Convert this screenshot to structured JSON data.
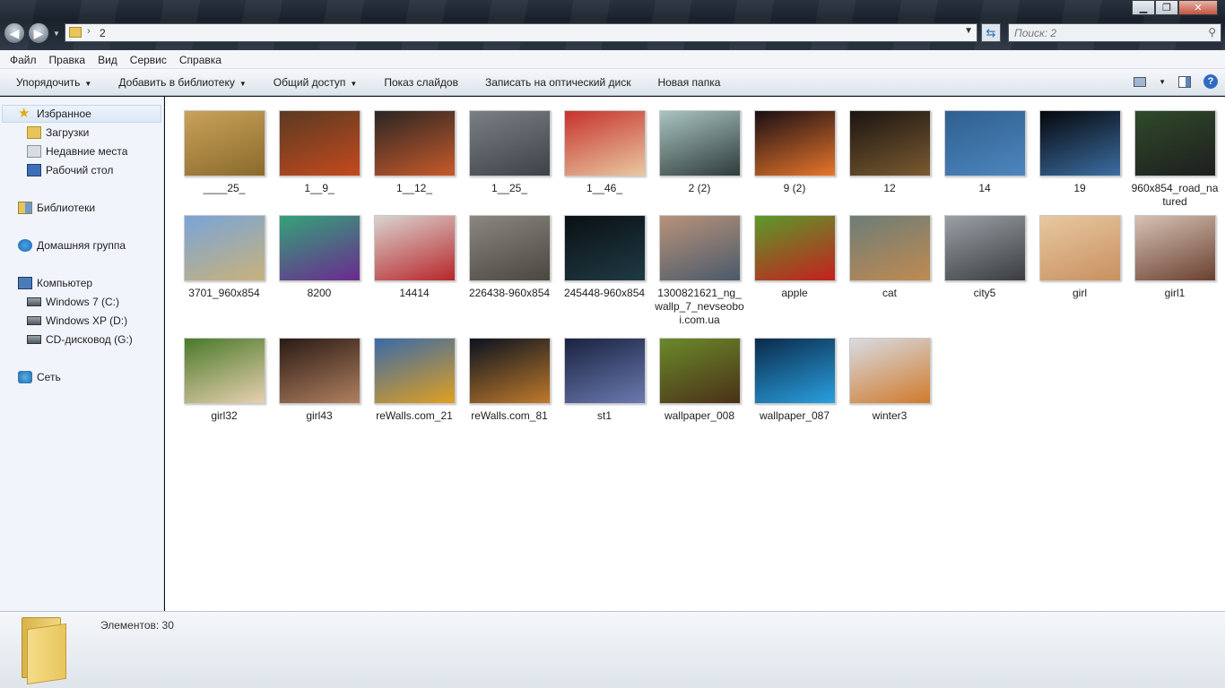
{
  "window": {
    "controls": {
      "minimize": "▁",
      "maximize": "❐",
      "close": "✕"
    }
  },
  "address": {
    "path": "2",
    "dropdown_icon": "chevron-down-icon"
  },
  "search": {
    "placeholder": "Поиск: 2"
  },
  "menu": [
    "Файл",
    "Правка",
    "Вид",
    "Сервис",
    "Справка"
  ],
  "toolbar": {
    "organize": "Упорядочить",
    "add_to_library": "Добавить в библиотеку",
    "share": "Общий доступ",
    "slideshow": "Показ слайдов",
    "burn": "Записать на оптический диск",
    "new_folder": "Новая папка",
    "help": "?"
  },
  "sidebar": {
    "favorites": "Избранное",
    "downloads": "Загрузки",
    "recent": "Недавние места",
    "desktop": "Рабочий стол",
    "libraries": "Библиотеки",
    "homegroup": "Домашняя группа",
    "computer": "Компьютер",
    "drive_c": "Windows 7 (C:)",
    "drive_d": "Windows XP (D:)",
    "drive_g": "CD-дисковод (G:)",
    "network": "Сеть"
  },
  "files": [
    {
      "name": "____25_",
      "colors": [
        "#c9a25a",
        "#8a6a2c"
      ]
    },
    {
      "name": "1__9_",
      "colors": [
        "#5a3a22",
        "#c44a1e"
      ]
    },
    {
      "name": "1__12_",
      "colors": [
        "#2a2624",
        "#c85a2a"
      ]
    },
    {
      "name": "1__25_",
      "colors": [
        "#7a7f86",
        "#3e4248"
      ]
    },
    {
      "name": "1__46_",
      "colors": [
        "#c7322e",
        "#e8c9a0"
      ]
    },
    {
      "name": "2 (2)",
      "colors": [
        "#a9c4c0",
        "#2e3b3a"
      ]
    },
    {
      "name": "9 (2)",
      "colors": [
        "#1a0e14",
        "#e8762a"
      ]
    },
    {
      "name": "12",
      "colors": [
        "#1b1512",
        "#7a5a30"
      ]
    },
    {
      "name": "14",
      "colors": [
        "#2f5f90",
        "#4d86bd"
      ]
    },
    {
      "name": "19",
      "colors": [
        "#05070b",
        "#3c6ea2"
      ]
    },
    {
      "name": "960x854_road_natured",
      "colors": [
        "#2f4a2a",
        "#1e1e1e"
      ]
    },
    {
      "name": "3701_960x854",
      "colors": [
        "#7aa4d8",
        "#c8b27a"
      ]
    },
    {
      "name": "8200",
      "colors": [
        "#34a27a",
        "#6b2a8f"
      ]
    },
    {
      "name": "14414",
      "colors": [
        "#d9d4cf",
        "#b8262a"
      ]
    },
    {
      "name": "226438-960x854",
      "colors": [
        "#8a8780",
        "#4a4640"
      ]
    },
    {
      "name": "245448-960x854",
      "colors": [
        "#0a1014",
        "#1f3a44"
      ]
    },
    {
      "name": "1300821621_ng_wallp_7_nevseoboi.com.ua",
      "colors": [
        "#b8927a",
        "#4a5a6a"
      ]
    },
    {
      "name": "apple",
      "colors": [
        "#5a9a2a",
        "#c5201e"
      ]
    },
    {
      "name": "cat",
      "colors": [
        "#6d7d78",
        "#c08a50"
      ]
    },
    {
      "name": "city5",
      "colors": [
        "#9aa0a6",
        "#3a3c40"
      ]
    },
    {
      "name": "girl",
      "colors": [
        "#e8c8a0",
        "#c89060"
      ]
    },
    {
      "name": "girl1",
      "colors": [
        "#d6c2b4",
        "#6a4030"
      ]
    },
    {
      "name": "girl32",
      "colors": [
        "#4a7a2a",
        "#e8d0b0"
      ]
    },
    {
      "name": "girl43",
      "colors": [
        "#2a1a14",
        "#b08060"
      ]
    },
    {
      "name": "reWalls.com_21",
      "colors": [
        "#3a6aa8",
        "#e0a020"
      ]
    },
    {
      "name": "reWalls.com_81",
      "colors": [
        "#0a1220",
        "#c07a2a"
      ]
    },
    {
      "name": "st1",
      "colors": [
        "#1a2240",
        "#6a7ab0"
      ]
    },
    {
      "name": "wallpaper_008",
      "colors": [
        "#6a8a2a",
        "#4a3018"
      ]
    },
    {
      "name": "wallpaper_087",
      "colors": [
        "#0a2a4a",
        "#2aa0e0"
      ]
    },
    {
      "name": "winter3",
      "colors": [
        "#d8dce4",
        "#d07a2a"
      ]
    }
  ],
  "status": {
    "count_text": "Элементов: 30"
  },
  "colors": {
    "accent": "#2f6cc0",
    "sidebar_bg": "#f1f5fb",
    "folder": "#e7c55b"
  }
}
